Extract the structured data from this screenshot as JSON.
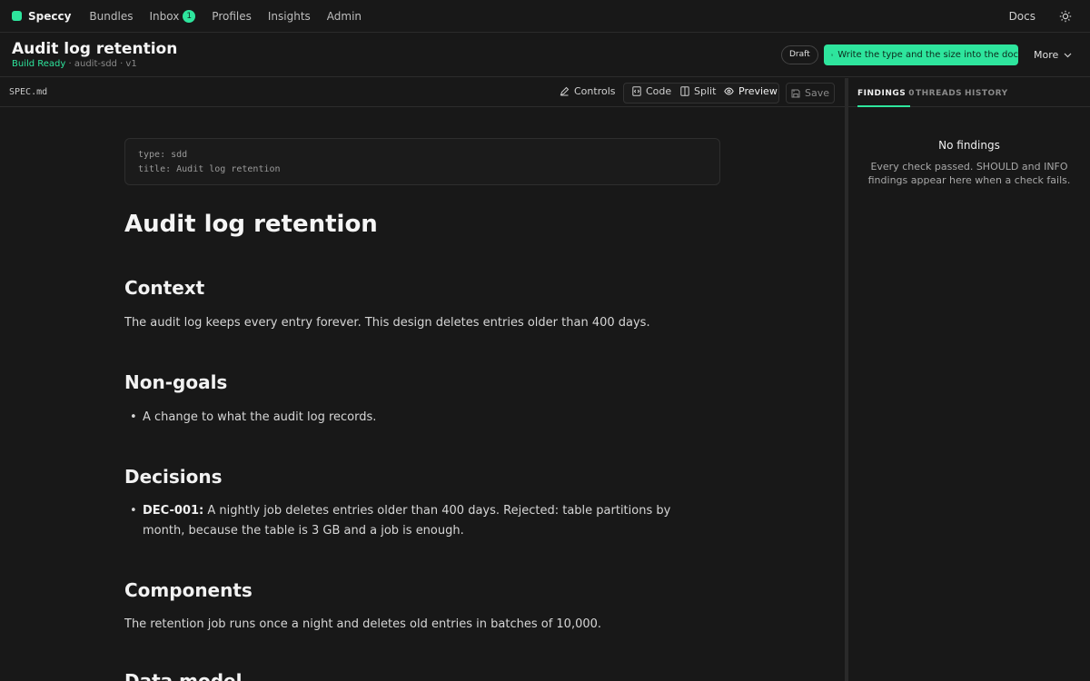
{
  "nav": {
    "brand": "Speccy",
    "items": [
      {
        "label": "Bundles"
      },
      {
        "label": "Inbox",
        "badge": "1"
      },
      {
        "label": "Profiles"
      },
      {
        "label": "Insights"
      },
      {
        "label": "Admin"
      }
    ],
    "docs": "Docs",
    "theme_icon": "sun-icon"
  },
  "header": {
    "title": "Audit log retention",
    "status": "Build Ready",
    "meta": "· audit-sdd · v1",
    "draft": "Draft",
    "primary_action": "Write the type and the size into the doc",
    "more": "More"
  },
  "toolbar": {
    "file": "SPEC.md",
    "controls": "Controls",
    "code": "Code",
    "split": "Split",
    "preview": "Preview",
    "save": "Save"
  },
  "doc": {
    "frontmatter": [
      "type: sdd",
      "title: Audit log retention"
    ],
    "title": "Audit log retention",
    "context_heading": "Context",
    "context_text": "The audit log keeps every entry forever. This design deletes entries older than 400 days.",
    "nongoals_heading": "Non-goals",
    "nongoals_item": "A change to what the audit log records.",
    "decisions_heading": "Decisions",
    "decision_id": "DEC-001:",
    "decision_text": "A nightly job deletes entries older than 400 days. Rejected: table partitions by month, because the table is 3 GB and a job is enough.",
    "components_heading": "Components",
    "components_text": "The retention job runs once a night and deletes old entries in batches of 10,000.",
    "datamodel_heading": "Data model"
  },
  "panel": {
    "tabs": [
      {
        "label": "FINDINGS",
        "count": "0"
      },
      {
        "label": "THREADS"
      },
      {
        "label": "HISTORY"
      }
    ],
    "empty_title": "No findings",
    "empty_desc": "Every check passed. SHOULD and INFO findings appear here when a check fails."
  },
  "colors": {
    "accent": "#2ee59d",
    "background": "#181818"
  }
}
